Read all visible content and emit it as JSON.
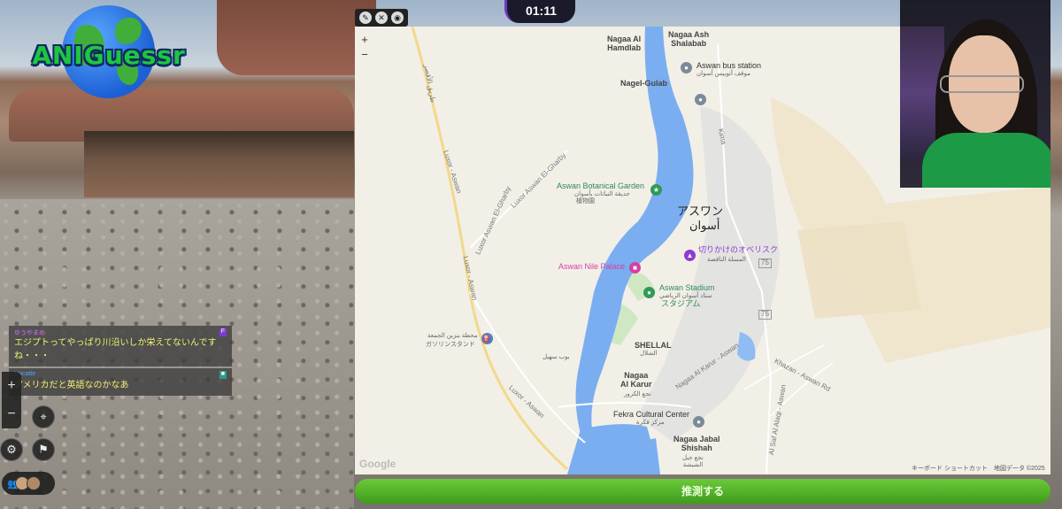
{
  "app": {
    "logo_text": "ANIGuessr",
    "timer": "01:11"
  },
  "map": {
    "labels": {
      "nagaa_al_hamdlab": "Nagaa Al\nHamdlab",
      "nagaa_ash_shalabab": "Nagaa Ash\nShalabab",
      "aswan_bus_station": "Aswan bus station",
      "aswan_bus_station_ar": "موقف أتوبيس أسوان",
      "nagel_gulab": "Nagel-Gulab",
      "aswan_botanical_garden": "Aswan Botanical Garden",
      "aswan_botanical_garden_ar": "حديقة النباتات بأسوان",
      "aswan_botanical_garden_ja": "植物園",
      "city_ja": "アスワン",
      "city_ar": "أسوان",
      "obelisk_ja": "切りかけのオベリスク",
      "obelisk_ar": "المسلة الناقصة",
      "aswan_nile_palace": "Aswan Nile Palace",
      "aswan_stadium": "Aswan Stadium",
      "aswan_stadium_ar": "ستاد أسوان الرياضي",
      "aswan_stadium_ja": "スタジアム",
      "gas_station_ar": "محطة بنزين الجمعة",
      "gas_station_ja": "ガソリンスタンド",
      "shellal": "SHELLAL",
      "shellal_ar": "الشلال",
      "ar_small": "بوب سهيل",
      "nagaa_al_karur": "Nagaa\nAl Karur",
      "nagaa_al_karur_ar": "نجع الكرور",
      "cultural_center": "Fekra Cultural Center",
      "cultural_center_ar": "مركز فكرة",
      "nagaa_jabal_shishah": "Nagaa Jabal\nShishah",
      "nagaa_jabal_shishah_ar": "نجع جبل\nالشيشة",
      "road_luxor_aswan_w": "Luxor - Aswan",
      "road_luxor_aswan_w2": "Luxor - Aswan",
      "road_luxor_aswan_el_gharby": "Luxor Aswan El-Gharby",
      "road_luxor_aswan_el_gharby2": "Luxor Aswan El-Gharby",
      "road_luxor_aswan_s": "Luxor - Aswan",
      "road_kima": "Kima",
      "road_nagaa_al_karur": "Nagaa Al Karur - Aswan",
      "road_khazan": "Khazan - Aswan Rd",
      "road_aswan_al_hasan": "Al Saf Al Alaqi - Aswan",
      "ar_road_top": "طريق الأقصر",
      "road_75": "75",
      "road_75b": "75"
    },
    "google": "Google",
    "attribution": "キーボード ショートカット　地図データ ©2025",
    "zoom_in": "+",
    "zoom_out": "−"
  },
  "map_tools": [
    "pencil-icon",
    "wrench-icon",
    "eye-icon"
  ],
  "guess_button": "推測する",
  "chat": [
    {
      "user": "ゆうやまめ",
      "badge": "F",
      "text": "エジプトってやっぱり川沿いしか栄えてないんです\nね・・・"
    },
    {
      "user": "Hacatte",
      "badge": "■",
      "text": "アメリカだと英語なのかなあ"
    }
  ],
  "controls": {
    "zoom_in": "+",
    "zoom_out": "−"
  },
  "colors": {
    "accent_green": "#4caf2a",
    "timer_bg": "#1a1a2a",
    "chat_text": "#f0f070",
    "nile": "#7aaef0"
  }
}
